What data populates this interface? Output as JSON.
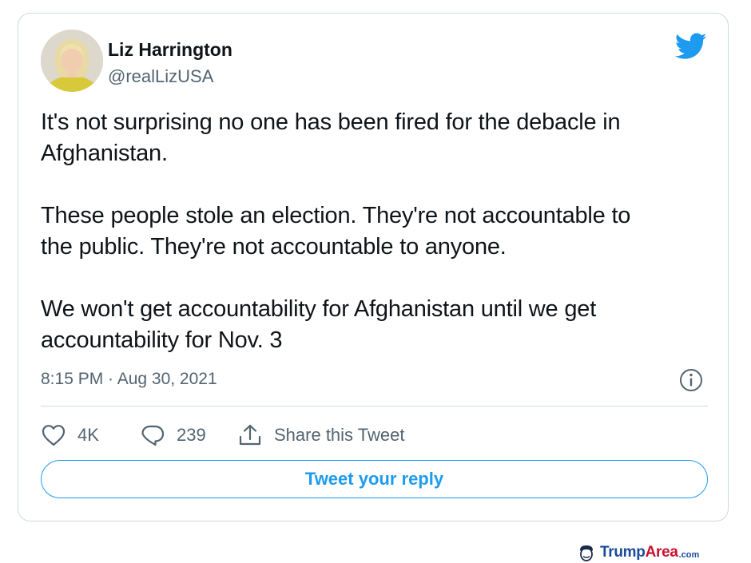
{
  "tweet": {
    "author": {
      "name": "Liz Harrington",
      "handle": "@realLizUSA",
      "avatar_icon": "profile-photo"
    },
    "paragraphs": [
      "It's not surprising no one has been fired for the debacle in\nAfghanistan.",
      "These people stole an election. They're not accountable to\nthe public. They're not accountable to anyone.",
      "We won't get accountability for Afghanistan until we get\naccountability for Nov. 3"
    ],
    "timestamp": "8:15 PM · Aug 30, 2021",
    "actions": {
      "like_count": "4K",
      "reply_count": "239",
      "share_label": "Share this Tweet"
    },
    "reply_button_label": "Tweet your reply"
  },
  "icons": {
    "brand": "twitter-bird-icon",
    "info": "info-icon",
    "like": "heart-icon",
    "reply": "speech-bubble-icon",
    "share": "share-icon"
  },
  "colors": {
    "accent": "#1d9bf0",
    "text": "#0f1419",
    "secondary_text": "#536471",
    "border": "#cfd9de"
  },
  "watermark": {
    "part1": "Trump",
    "part2": "Area",
    "part3": ".com"
  }
}
